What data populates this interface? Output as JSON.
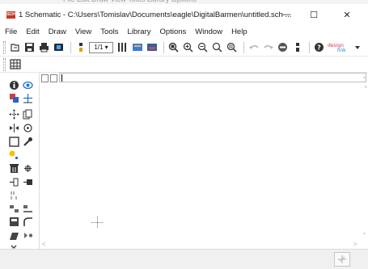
{
  "window": {
    "title": "1 Schematic - C:\\Users\\Tomislav\\Documents\\eagle\\DigitalBarmen\\untitled.sch ...",
    "app_icon_text": "SCH",
    "minimize": "—",
    "maximize": "☐",
    "close": "✕"
  },
  "menu": {
    "items": [
      "File",
      "Edit",
      "Draw",
      "View",
      "Tools",
      "Library",
      "Options",
      "Window",
      "Help"
    ]
  },
  "toolbar": {
    "sheet_select": "1/1 ▾",
    "design_link_label": "design link"
  },
  "command": {
    "value": ""
  },
  "colors": {
    "accent": "#1e6fd9",
    "brand": "#c0392b"
  }
}
